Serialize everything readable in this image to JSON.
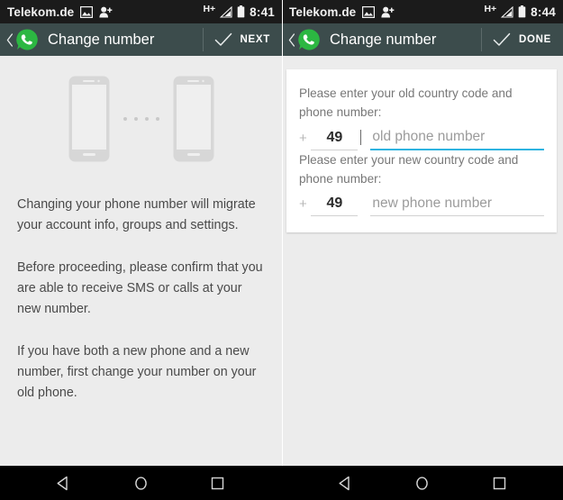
{
  "panels": [
    {
      "id": "left",
      "status_bar": {
        "carrier": "Telekom.de",
        "network": "H+",
        "clock": "8:41",
        "icons": [
          "screenshot-icon",
          "add-contact-icon",
          "signal-icon",
          "battery-icon"
        ]
      },
      "action_bar": {
        "title": "Change number",
        "action_label": "NEXT",
        "back_icon": "back-chevron-icon",
        "app_icon": "whatsapp-logo-icon",
        "action_icon": "check-icon"
      },
      "illustration": {
        "name": "two-phones-migration-illustration",
        "dots": 4
      },
      "paragraphs": [
        "Changing your phone number will migrate your account info, groups and settings.",
        "Before proceeding, please confirm that you are able to receive SMS or calls at your new number.",
        "If you have both a new phone and a new number, first change your number on your old phone."
      ]
    },
    {
      "id": "right",
      "status_bar": {
        "carrier": "Telekom.de",
        "network": "H+",
        "clock": "8:44",
        "icons": [
          "screenshot-icon",
          "add-contact-icon",
          "signal-icon",
          "battery-icon"
        ]
      },
      "action_bar": {
        "title": "Change number",
        "action_label": "DONE",
        "back_icon": "back-chevron-icon",
        "app_icon": "whatsapp-logo-icon",
        "action_icon": "check-icon"
      },
      "form": {
        "fields": [
          {
            "label": "Please enter your old country code and phone number:",
            "plus": "+",
            "country_code": "49",
            "phone_value": "",
            "phone_placeholder": "old phone number",
            "focused": true
          },
          {
            "label": "Please enter your new country code and phone number:",
            "plus": "+",
            "country_code": "49",
            "phone_value": "",
            "phone_placeholder": "new phone number",
            "focused": false
          }
        ]
      }
    }
  ],
  "nav_bar": {
    "buttons": [
      "back-icon",
      "home-icon",
      "recents-icon"
    ]
  },
  "colors": {
    "action_bar": "#3c4c4c",
    "status_bar": "#1b1b1b",
    "page_bg": "#ececec",
    "card_bg": "#ffffff",
    "accent_focus": "#2eb4e0",
    "whatsapp_green": "#2cb742",
    "nav_bar": "#000000"
  }
}
